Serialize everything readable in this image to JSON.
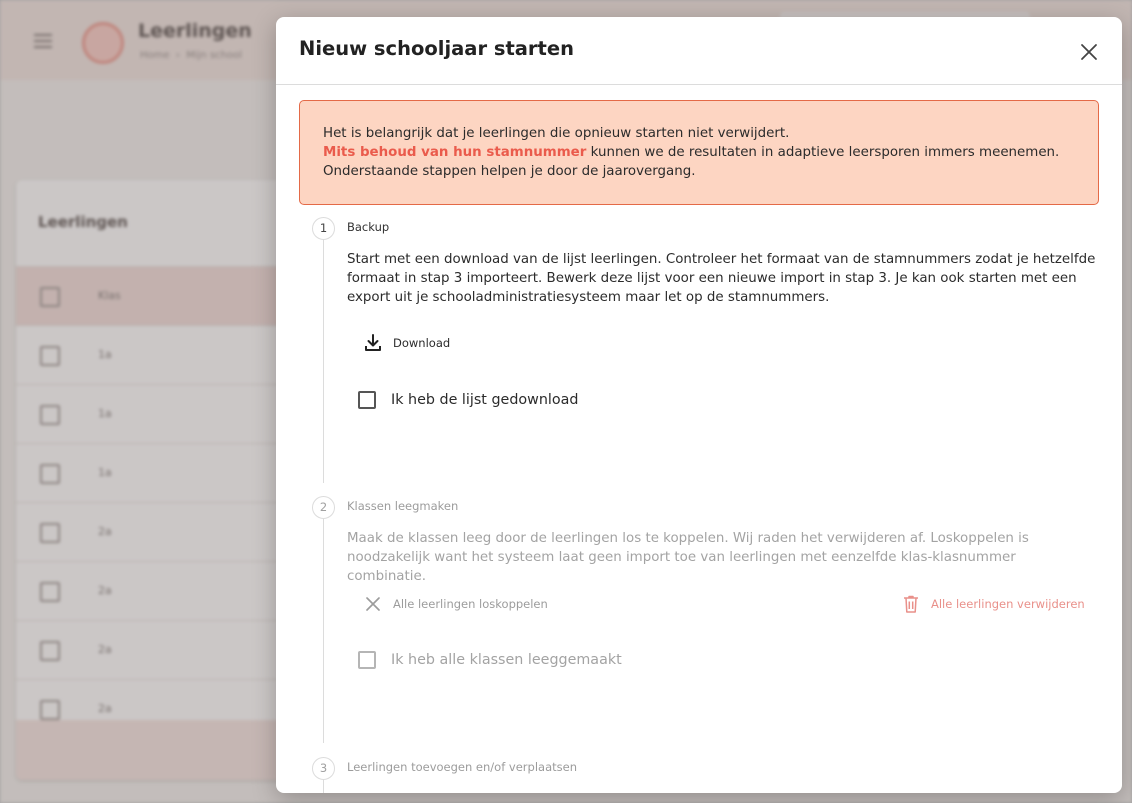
{
  "background": {
    "page_title": "Leerlingen",
    "breadcrumb": [
      "Home",
      "Mijn school"
    ],
    "card_title": "Leerlingen",
    "table_head": "Klas",
    "rows": [
      "1a",
      "1a",
      "1a",
      "2a",
      "2a",
      "2a",
      "2a"
    ]
  },
  "modal": {
    "title": "Nieuw schooljaar starten",
    "close_icon": "close-icon",
    "alert": {
      "line1": "Het is belangrijk dat je leerlingen die opnieuw starten niet verwijdert.",
      "highlight": "Mits behoud van hun stamnummer",
      "line2_rest": " kunnen we de resultaten in adaptieve leersporen immers meenemen.",
      "line3": "Onderstaande stappen helpen je door de jaarovergang."
    },
    "steps": [
      {
        "number": "1",
        "title": "Backup",
        "description": "Start met een download van de lijst leerlingen. Controleer het formaat van de stamnummers zodat je hetzelfde formaat in stap 3 importeert. Bewerk deze lijst voor een nieuwe import in stap 3. Je kan ook starten met een export uit je schooladministratiesysteem maar let op de stamnummers.",
        "download_label": "Download",
        "download_icon": "download-icon",
        "checkbox_label": "Ik heb de lijst gedownload"
      },
      {
        "number": "2",
        "title": "Klassen leegmaken",
        "description": "Maak de klassen leeg door de leerlingen los te koppelen. Wij raden het verwijderen af. Loskoppelen is noodzakelijk want het systeem laat geen import toe van leerlingen met eenzelfde klas-klasnummer combinatie.",
        "unlink_label": "Alle leerlingen loskoppelen",
        "unlink_icon": "x-icon",
        "delete_label": "Alle leerlingen verwijderen",
        "delete_icon": "trash-icon",
        "checkbox_label": "Ik heb alle klassen leeggemaakt"
      },
      {
        "number": "3",
        "title": "Leerlingen toevoegen en/of verplaatsen"
      }
    ]
  },
  "colors": {
    "accent": "#ea5b4c",
    "alert_bg": "#fdd5c2",
    "alert_border": "#e46a47",
    "danger_muted": "#e9908a"
  }
}
